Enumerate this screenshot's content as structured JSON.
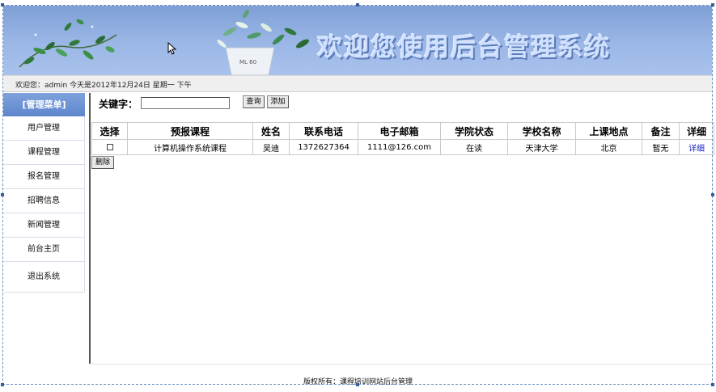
{
  "banner": {
    "title": "欢迎您使用后台管理系统",
    "pot_label": "ML 60"
  },
  "welcome": {
    "text": "欢迎您：admin   今天是2012年12月24日   星期一   下午"
  },
  "sidebar": {
    "header": "[管理菜单]",
    "items": [
      {
        "label": "用户管理"
      },
      {
        "label": "课程管理"
      },
      {
        "label": "报名管理"
      },
      {
        "label": "招聘信息"
      },
      {
        "label": "新闻管理"
      },
      {
        "label": "前台主页"
      },
      {
        "label": "退出系统"
      }
    ]
  },
  "search": {
    "label": "关键字：",
    "value": "",
    "query_label": "查询",
    "add_label": "添加"
  },
  "table": {
    "headers": [
      "选择",
      "预报课程",
      "姓名",
      "联系电话",
      "电子邮箱",
      "学院状态",
      "学校名称",
      "上课地点",
      "备注",
      "详细"
    ],
    "rows": [
      {
        "checked": false,
        "course": "计算机操作系统课程",
        "name": "吴迪",
        "phone": "1372627364",
        "email": "1111@126.com",
        "status": "在读",
        "school": "天津大学",
        "location": "北京",
        "note": "暂无",
        "detail": "详细"
      }
    ],
    "delete_label": "删除"
  },
  "footer": {
    "text": "版权所有：课程培训网站后台管理"
  },
  "colors": {
    "banner": "#8eacdf",
    "menu_header": "#6d93d4",
    "link": "#1a25c4"
  }
}
